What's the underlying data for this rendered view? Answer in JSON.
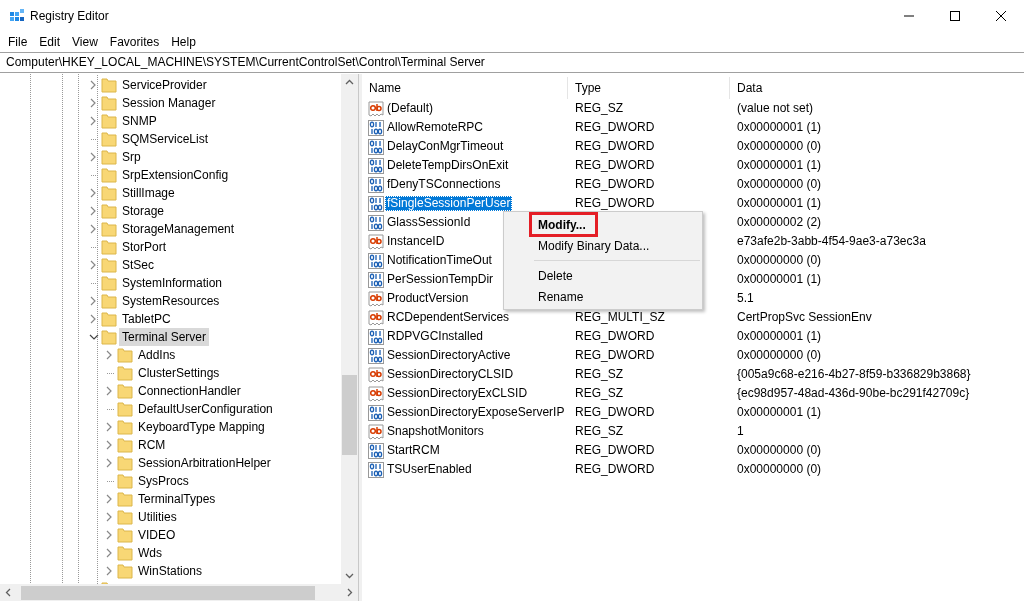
{
  "window": {
    "title": "Registry Editor"
  },
  "menu_bar": [
    "File",
    "Edit",
    "View",
    "Favorites",
    "Help"
  ],
  "address_bar": {
    "value": "Computer\\HKEY_LOCAL_MACHINE\\SYSTEM\\CurrentControlSet\\Control\\Terminal Server"
  },
  "tree": [
    {
      "name": "ServiceProvider",
      "kind": "collapsed",
      "selected": false
    },
    {
      "name": "Session Manager",
      "kind": "collapsed",
      "selected": false
    },
    {
      "name": "SNMP",
      "kind": "collapsed",
      "selected": false
    },
    {
      "name": "SQMServiceList",
      "kind": "leaf",
      "selected": false
    },
    {
      "name": "Srp",
      "kind": "collapsed",
      "selected": false
    },
    {
      "name": "SrpExtensionConfig",
      "kind": "leaf",
      "selected": false
    },
    {
      "name": "StillImage",
      "kind": "collapsed",
      "selected": false
    },
    {
      "name": "Storage",
      "kind": "collapsed",
      "selected": false
    },
    {
      "name": "StorageManagement",
      "kind": "collapsed",
      "selected": false
    },
    {
      "name": "StorPort",
      "kind": "leaf",
      "selected": false
    },
    {
      "name": "StSec",
      "kind": "collapsed",
      "selected": false
    },
    {
      "name": "SystemInformation",
      "kind": "leaf",
      "selected": false
    },
    {
      "name": "SystemResources",
      "kind": "collapsed",
      "selected": false
    },
    {
      "name": "TabletPC",
      "kind": "collapsed",
      "selected": false
    },
    {
      "name": "Terminal Server",
      "kind": "expanded",
      "selected": true,
      "children": [
        {
          "name": "AddIns",
          "kind": "collapsed",
          "selected": false
        },
        {
          "name": "ClusterSettings",
          "kind": "leaf",
          "selected": false
        },
        {
          "name": "ConnectionHandler",
          "kind": "collapsed",
          "selected": false
        },
        {
          "name": "DefaultUserConfiguration",
          "kind": "leaf",
          "selected": false
        },
        {
          "name": "KeyboardType Mapping",
          "kind": "collapsed",
          "selected": false
        },
        {
          "name": "RCM",
          "kind": "collapsed",
          "selected": false
        },
        {
          "name": "SessionArbitrationHelper",
          "kind": "collapsed",
          "selected": false
        },
        {
          "name": "SysProcs",
          "kind": "leaf",
          "selected": false
        },
        {
          "name": "TerminalTypes",
          "kind": "collapsed",
          "selected": false
        },
        {
          "name": "Utilities",
          "kind": "collapsed",
          "selected": false
        },
        {
          "name": "VIDEO",
          "kind": "collapsed",
          "selected": false
        },
        {
          "name": "Wds",
          "kind": "collapsed",
          "selected": false
        },
        {
          "name": "WinStations",
          "kind": "collapsed",
          "selected": false
        }
      ]
    }
  ],
  "values_table": {
    "columns": [
      "Name",
      "Type",
      "Data"
    ],
    "rows": [
      {
        "name": "(Default)",
        "type": "REG_SZ",
        "data": "(value not set)",
        "kind": "string",
        "selected": false
      },
      {
        "name": "AllowRemoteRPC",
        "type": "REG_DWORD",
        "data": "0x00000001 (1)",
        "kind": "binary",
        "selected": false
      },
      {
        "name": "DelayConMgrTimeout",
        "type": "REG_DWORD",
        "data": "0x00000000 (0)",
        "kind": "binary",
        "selected": false
      },
      {
        "name": "DeleteTempDirsOnExit",
        "type": "REG_DWORD",
        "data": "0x00000001 (1)",
        "kind": "binary",
        "selected": false
      },
      {
        "name": "fDenyTSConnections",
        "type": "REG_DWORD",
        "data": "0x00000000 (0)",
        "kind": "binary",
        "selected": false
      },
      {
        "name": "fSingleSessionPerUser",
        "type": "REG_DWORD",
        "data": "0x00000001 (1)",
        "kind": "binary",
        "selected": true
      },
      {
        "name": "GlassSessionId",
        "type": "",
        "data": "0x00000002 (2)",
        "kind": "binary",
        "selected": false
      },
      {
        "name": "InstanceID",
        "type": "",
        "data": "e73afe2b-3abb-4f54-9ae3-a73ec3a",
        "kind": "string",
        "selected": false
      },
      {
        "name": "NotificationTimeOut",
        "type": "",
        "data": "0x00000000 (0)",
        "kind": "binary",
        "selected": false
      },
      {
        "name": "PerSessionTempDir",
        "type": "",
        "data": "0x00000001 (1)",
        "kind": "binary",
        "selected": false
      },
      {
        "name": "ProductVersion",
        "type": "",
        "data": "5.1",
        "kind": "string",
        "selected": false
      },
      {
        "name": "RCDependentServices",
        "type": "REG_MULTI_SZ",
        "data": "CertPropSvc SessionEnv",
        "kind": "string",
        "selected": false
      },
      {
        "name": "RDPVGCInstalled",
        "type": "REG_DWORD",
        "data": "0x00000001 (1)",
        "kind": "binary",
        "selected": false
      },
      {
        "name": "SessionDirectoryActive",
        "type": "REG_DWORD",
        "data": "0x00000000 (0)",
        "kind": "binary",
        "selected": false
      },
      {
        "name": "SessionDirectoryCLSID",
        "type": "REG_SZ",
        "data": "{005a9c68-e216-4b27-8f59-b336829b3868}",
        "kind": "string",
        "selected": false
      },
      {
        "name": "SessionDirectoryExCLSID",
        "type": "REG_SZ",
        "data": "{ec98d957-48ad-436d-90be-bc291f42709c}",
        "kind": "string",
        "selected": false
      },
      {
        "name": "SessionDirectoryExposeServerIP",
        "type": "REG_DWORD",
        "data": "0x00000001 (1)",
        "kind": "binary",
        "selected": false
      },
      {
        "name": "SnapshotMonitors",
        "type": "REG_SZ",
        "data": "1",
        "kind": "string",
        "selected": false
      },
      {
        "name": "StartRCM",
        "type": "REG_DWORD",
        "data": "0x00000000 (0)",
        "kind": "binary",
        "selected": false
      },
      {
        "name": "TSUserEnabled",
        "type": "REG_DWORD",
        "data": "0x00000000 (0)",
        "kind": "binary",
        "selected": false
      }
    ]
  },
  "context_menu": [
    {
      "kind": "item",
      "label": "Modify...",
      "default": true,
      "marked": true
    },
    {
      "kind": "item",
      "label": "Modify Binary Data...",
      "default": false,
      "marked": false
    },
    {
      "kind": "separator"
    },
    {
      "kind": "item",
      "label": "Delete",
      "default": false,
      "marked": false
    },
    {
      "kind": "item",
      "label": "Rename",
      "default": false,
      "marked": false
    }
  ]
}
